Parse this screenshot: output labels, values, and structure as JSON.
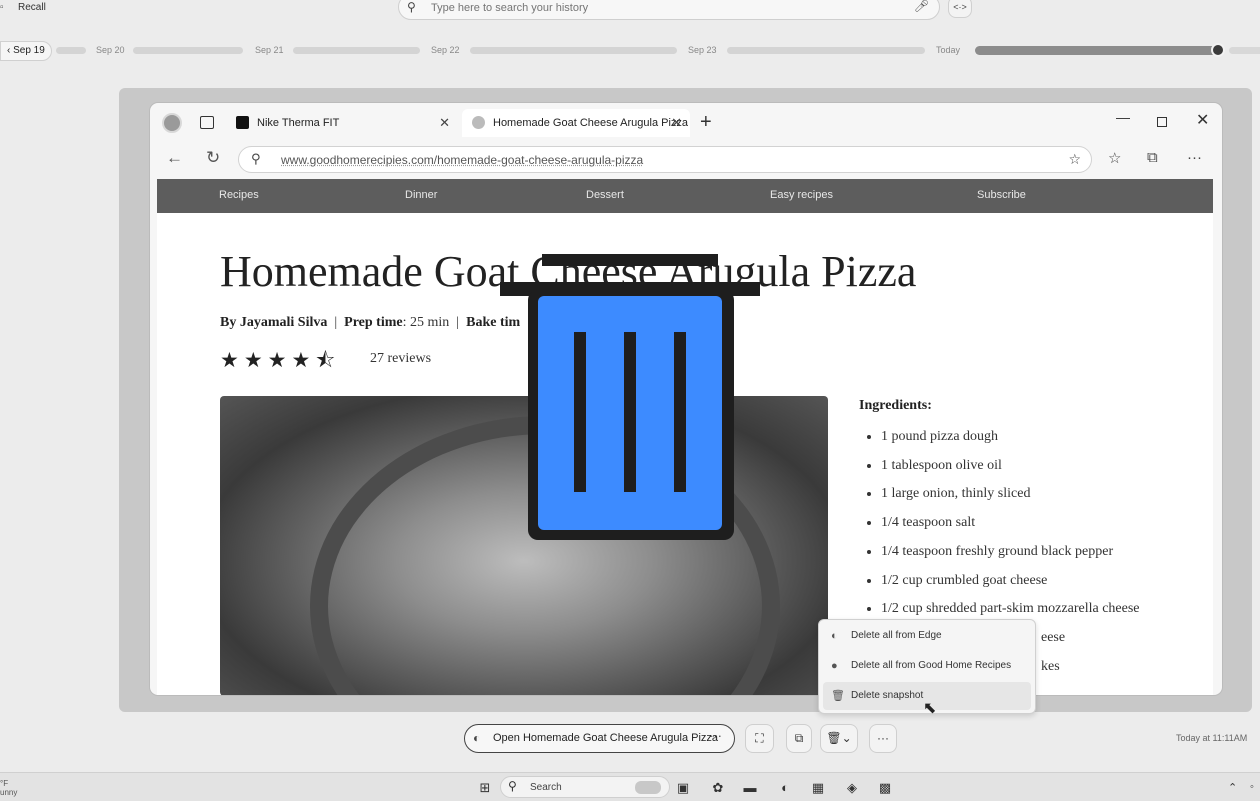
{
  "recall": {
    "app_title": "Recall",
    "search_placeholder": "Type here to search your history",
    "code_icon": "<·>"
  },
  "timeline": {
    "back_label": "Sep 19",
    "labels": [
      "Sep 20",
      "Sep 21",
      "Sep 22",
      "Sep 23",
      "Today"
    ]
  },
  "browser": {
    "tabs": [
      {
        "label": "Nike Therma FIT"
      },
      {
        "label": "Homemade Goat Cheese Arugula Pizza"
      }
    ],
    "url": "www.goodhomerecipies.com/homemade-goat-cheese-arugula-pizza"
  },
  "site": {
    "nav": [
      "Recipes",
      "Dinner",
      "Dessert",
      "Easy recipes",
      "Subscribe"
    ],
    "title": "Homemade Goat Cheese Arugula Pizza",
    "meta": {
      "author": "By Jayamali Silva",
      "prep_label": "Prep time",
      "prep_value": ": 25 min",
      "bake_label": "Bake tim"
    },
    "rating": 4.5,
    "reviews": "27 reviews",
    "ingredients_heading": "Ingredients:",
    "ingredients": [
      "1 pound pizza dough",
      "1 tablespoon olive oil",
      "1 large onion, thinly sliced",
      "1/4 teaspoon salt",
      "1/4 teaspoon freshly ground black pepper",
      "1/2 cup crumbled goat cheese",
      "1/2 cup shredded part-skim mozzarella cheese",
      "eese",
      "kes"
    ]
  },
  "menu": {
    "items": [
      {
        "label": "Delete all from Edge",
        "icon": "edge-icon"
      },
      {
        "label": "Delete all from Good Home Recipes",
        "icon": "site-icon"
      },
      {
        "label": "Delete snapshot",
        "icon": "trash-icon"
      }
    ]
  },
  "actions": {
    "open_label": "Open Homemade Goat Cheese Arugula Pizza",
    "more": "···",
    "timestamp": "Today at 11:11AM"
  },
  "taskbar": {
    "weather_temp": "°F",
    "weather_desc": "unny",
    "search_label": "Search"
  },
  "colors": {
    "trash_fill": "#3d8bff",
    "trash_outline": "#1e1e1e"
  }
}
